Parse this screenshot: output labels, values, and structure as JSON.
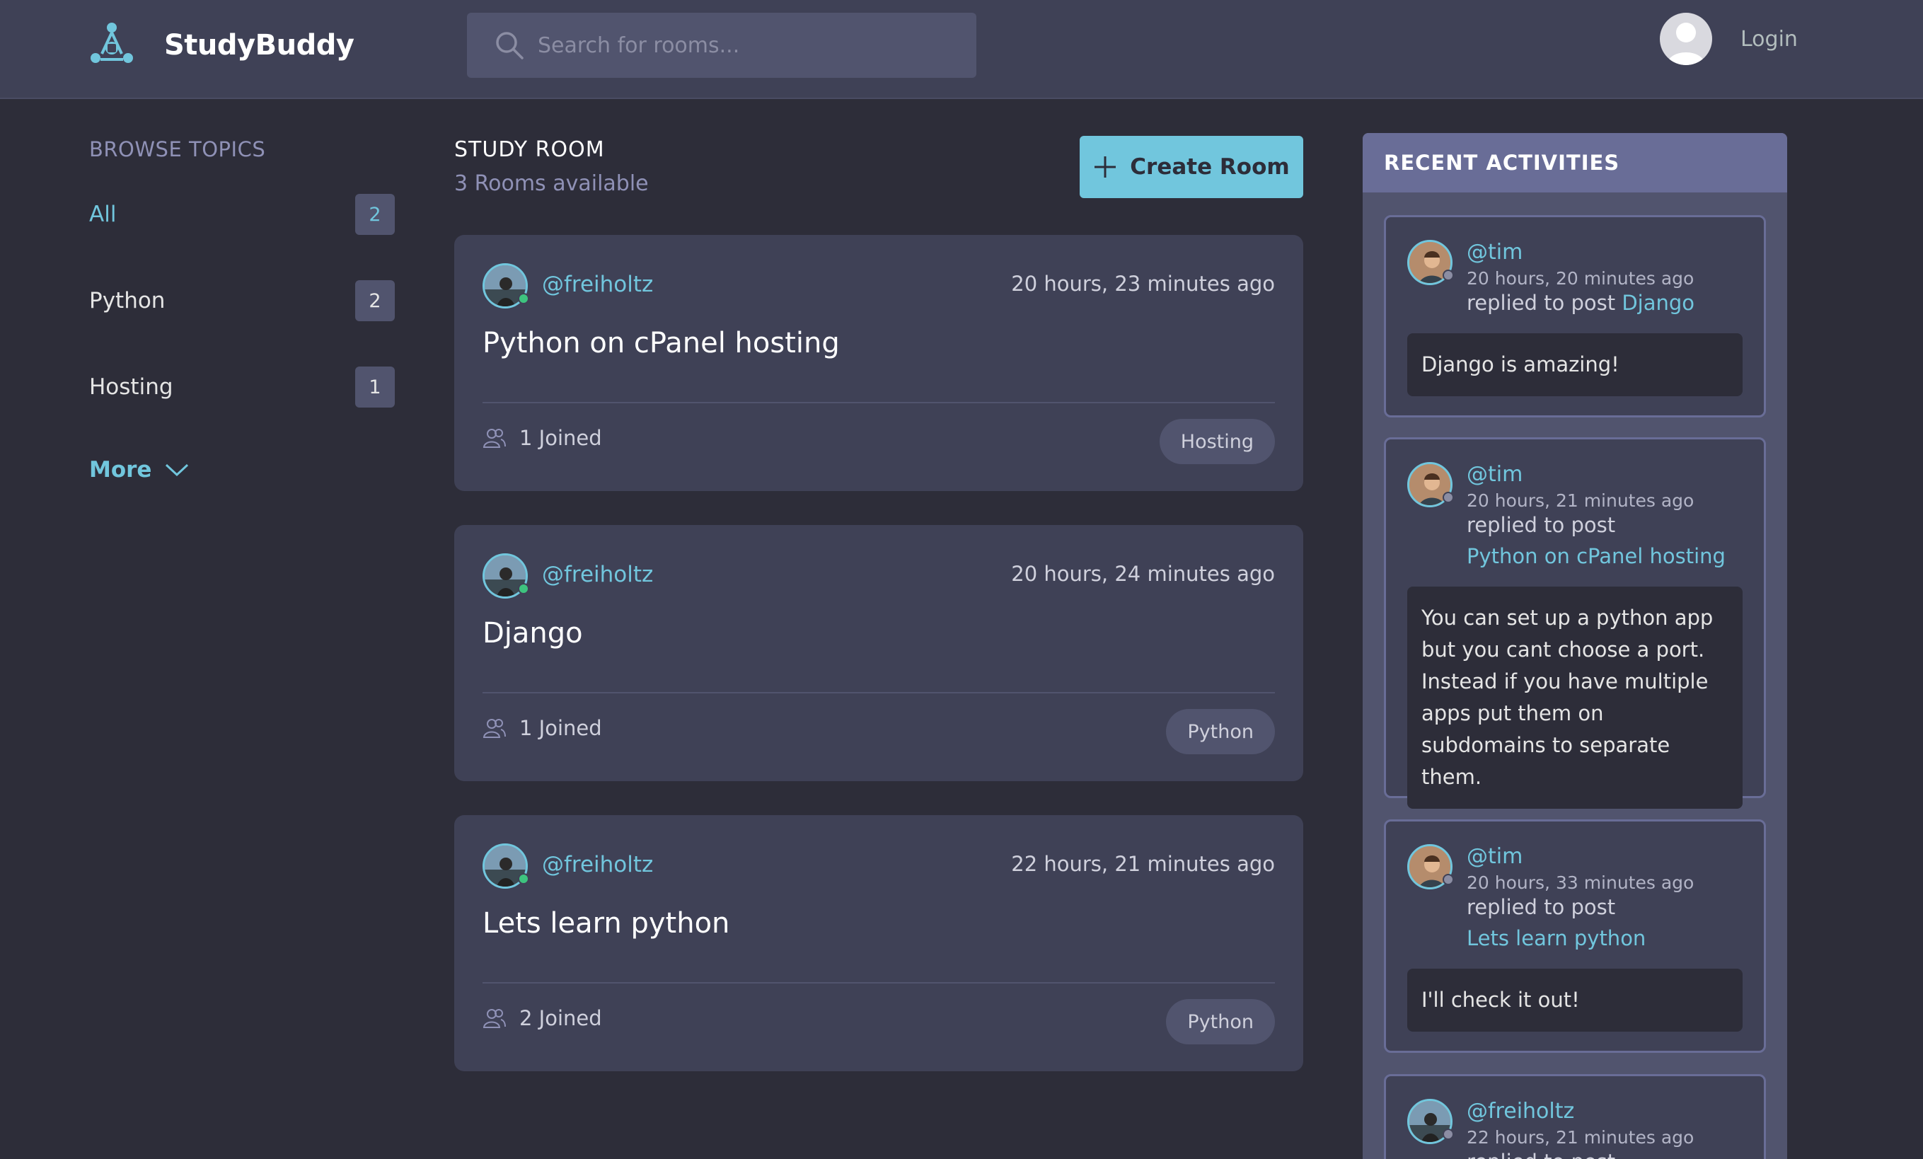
{
  "header": {
    "brand": "StudyBuddy",
    "search_placeholder": "Search for rooms...",
    "login_label": "Login"
  },
  "sidebar": {
    "heading": "BROWSE TOPICS",
    "topics": [
      {
        "label": "All",
        "count": "2"
      },
      {
        "label": "Python",
        "count": "2"
      },
      {
        "label": "Hosting",
        "count": "1"
      }
    ],
    "more_label": "More"
  },
  "main": {
    "title": "STUDY ROOM",
    "subtitle": "3 Rooms available",
    "create_label": "Create Room",
    "rooms": [
      {
        "host": "@freiholtz",
        "time": "20 hours, 23 minutes ago",
        "name": "Python on cPanel hosting",
        "joined": "1 Joined",
        "topic": "Hosting"
      },
      {
        "host": "@freiholtz",
        "time": "20 hours, 24 minutes ago",
        "name": "Django",
        "joined": "1 Joined",
        "topic": "Python"
      },
      {
        "host": "@freiholtz",
        "time": "22 hours, 21 minutes ago",
        "name": "Lets learn python",
        "joined": "2 Joined",
        "topic": "Python"
      }
    ]
  },
  "activity": {
    "heading": "RECENT ACTIVITIES",
    "items": [
      {
        "user": "@tim",
        "time": "20 hours, 20 minutes ago",
        "action": "replied to post",
        "post": "Django",
        "message": "Django is amazing!"
      },
      {
        "user": "@tim",
        "time": "20 hours, 21 minutes ago",
        "action": "replied to post",
        "post": "Python on cPanel hosting",
        "message": "You can set up a python app but you cant choose a port. Instead if you have multiple apps put them on subdomains to separate them."
      },
      {
        "user": "@tim",
        "time": "20 hours, 33 minutes ago",
        "action": "replied to post",
        "post": "Lets learn python",
        "message": "I'll check it out!"
      },
      {
        "user": "@freiholtz",
        "time": "22 hours, 21 minutes ago",
        "action": "replied to post"
      }
    ]
  },
  "colors": {
    "background": "#2d2d39",
    "surface": "#3f4156",
    "accent": "#71c6dd",
    "muted": "#8f91b6"
  }
}
